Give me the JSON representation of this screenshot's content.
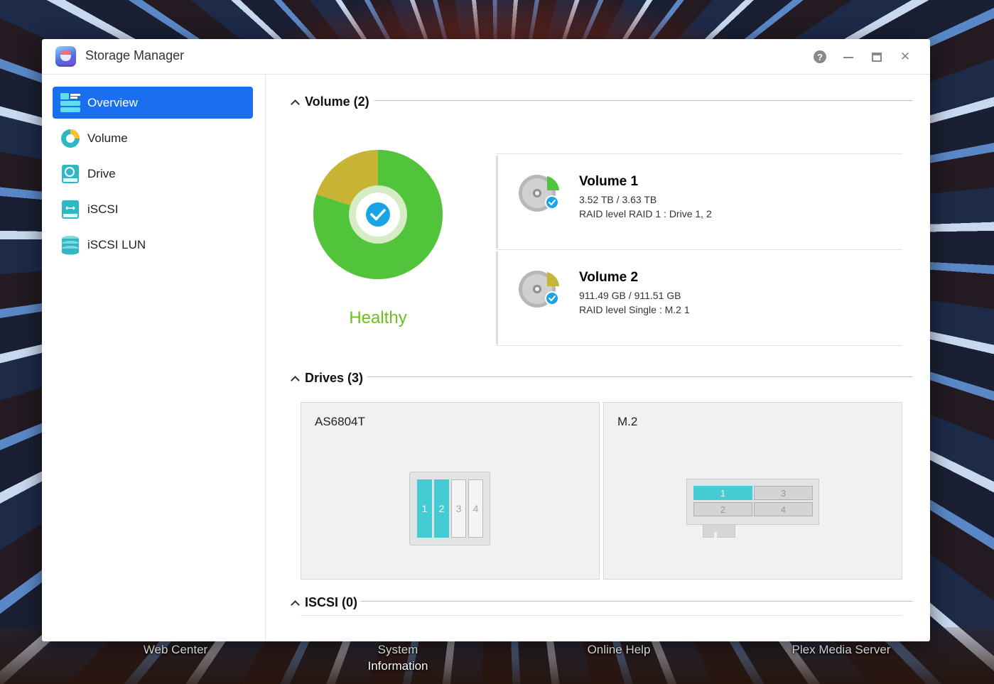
{
  "window": {
    "title": "Storage Manager"
  },
  "titlebar": {
    "help_icon": "question-icon",
    "minimize_icon": "minimize-icon",
    "maximize_icon": "maximize-icon",
    "close_icon": "close-icon",
    "help_glyph": "?",
    "close_glyph": "✕"
  },
  "sidebar": {
    "items": [
      {
        "label": "Overview",
        "icon": "overview-icon",
        "active": true
      },
      {
        "label": "Volume",
        "icon": "volume-icon"
      },
      {
        "label": "Drive",
        "icon": "drive-icon"
      },
      {
        "label": "iSCSI",
        "icon": "iscsi-icon"
      },
      {
        "label": "iSCSI LUN",
        "icon": "iscsi-lun-icon"
      }
    ]
  },
  "volume_section": {
    "heading": "Volume (2)",
    "status": "Healthy",
    "usage_chart": {
      "used_fraction": 0.8,
      "used_color": "#52c43c",
      "other_color": "#c8b434"
    },
    "volumes": [
      {
        "name": "Volume 1",
        "capacity": "3.52 TB / 3.63 TB",
        "raid": "RAID level RAID 1 : Drive 1, 2",
        "wedge_color": "#52c43c"
      },
      {
        "name": "Volume 2",
        "capacity": "911.49 GB / 911.51 GB",
        "raid": "RAID level Single : M.2 1",
        "wedge_color": "#c8b434"
      }
    ]
  },
  "drives_section": {
    "heading": "Drives (3)",
    "enclosures": [
      {
        "name": "AS6804T",
        "bays": [
          "1",
          "2",
          "3",
          "4"
        ],
        "used_bays": [
          1,
          2
        ]
      },
      {
        "name": "M.2",
        "slots": [
          "1",
          "3",
          "2",
          "4"
        ],
        "used_slots": [
          1
        ]
      }
    ]
  },
  "iscsi_section": {
    "heading": "ISCSI (0)"
  },
  "desktop": {
    "shortcuts": [
      {
        "label": "Web Center"
      },
      {
        "label": "System Information"
      },
      {
        "label": "Online Help"
      },
      {
        "label": "Plex Media Server"
      }
    ]
  },
  "colors": {
    "accent": "#1a6ef0",
    "healthy": "#6dbf1e",
    "drive_used": "#45cbd3"
  }
}
